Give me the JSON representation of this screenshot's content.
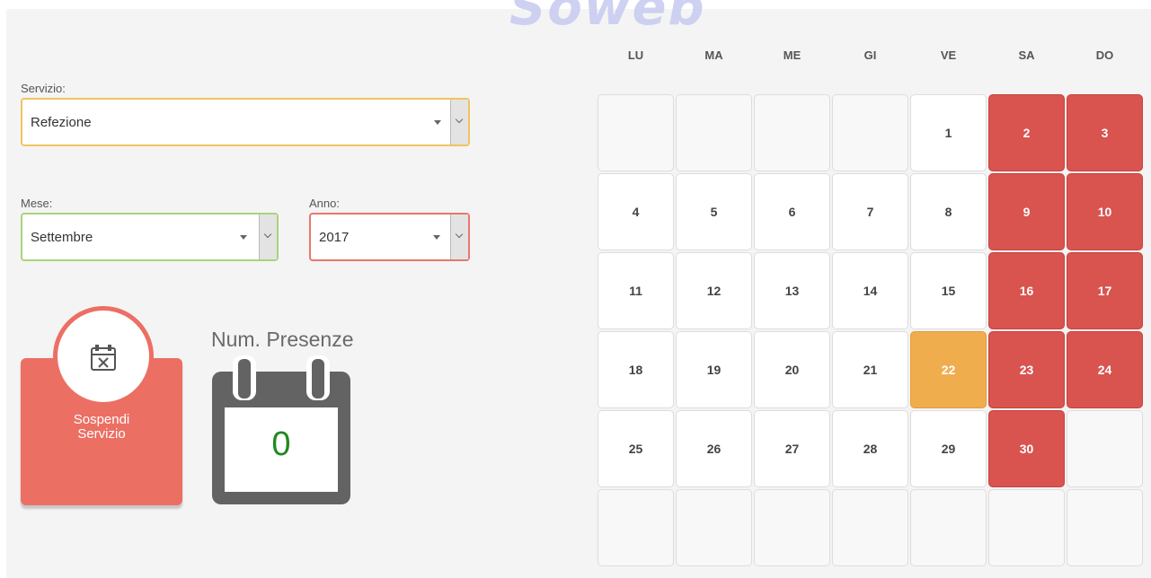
{
  "brand": {
    "text": "Soweb"
  },
  "form": {
    "servizio": {
      "label": "Servizio:",
      "value": "Refezione"
    },
    "mese": {
      "label": "Mese:",
      "value": "Settembre"
    },
    "anno": {
      "label": "Anno:",
      "value": "2017"
    }
  },
  "suspend": {
    "line1": "Sospendi",
    "line2": "Servizio",
    "icon": "calendar-x-icon"
  },
  "presenze": {
    "title": "Num. Presenze",
    "count": "0",
    "icon": "calendar-icon"
  },
  "calendar": {
    "weekdays": [
      "LU",
      "MA",
      "ME",
      "GI",
      "VE",
      "SA",
      "DO"
    ],
    "weeks": [
      [
        null,
        null,
        null,
        null,
        "1",
        "2",
        "3"
      ],
      [
        "4",
        "5",
        "6",
        "7",
        "8",
        "9",
        "10"
      ],
      [
        "11",
        "12",
        "13",
        "14",
        "15",
        "16",
        "17"
      ],
      [
        "18",
        "19",
        "20",
        "21",
        "22",
        "23",
        "24"
      ],
      [
        "25",
        "26",
        "27",
        "28",
        "29",
        "30",
        null
      ],
      [
        null,
        null,
        null,
        null,
        null,
        null,
        null
      ]
    ],
    "highlighted_days": [
      "22"
    ],
    "colors": {
      "weekend": "#d9534f",
      "highlight": "#f0ad4e",
      "suspend": "#ec6f64"
    }
  }
}
